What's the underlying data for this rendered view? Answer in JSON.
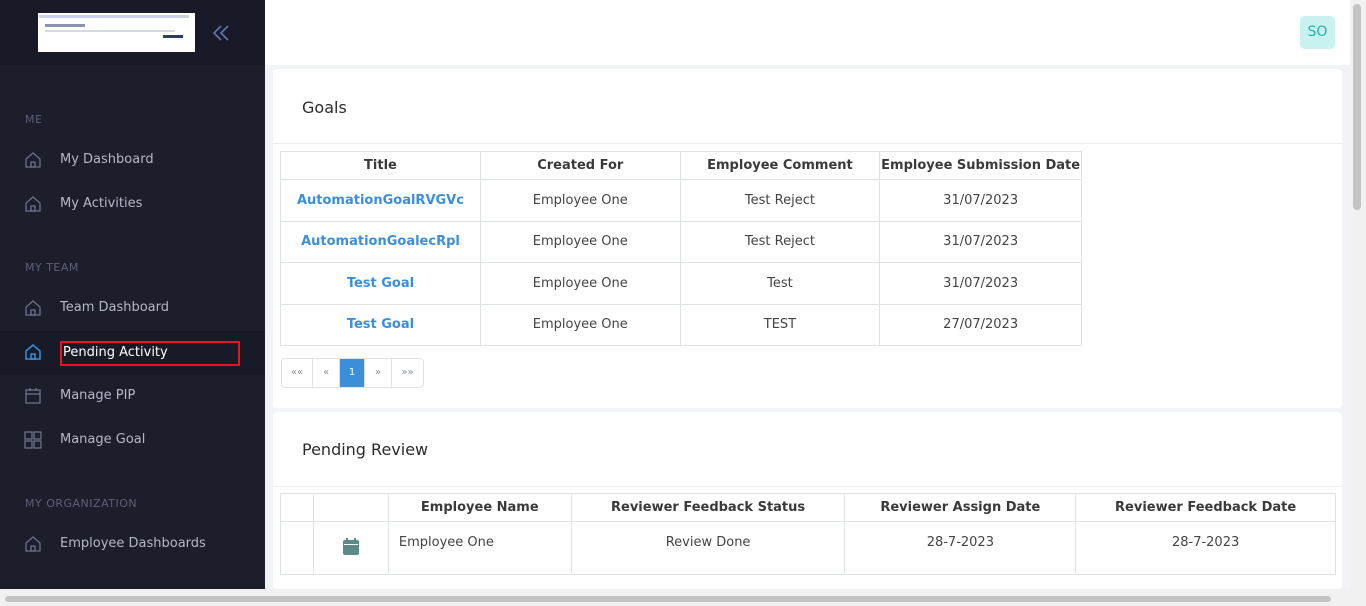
{
  "sidebar": {
    "sections": {
      "me": "ME",
      "my_team": "MY TEAM",
      "my_org": "MY ORGANIZATION"
    },
    "items": [
      {
        "label": "My Dashboard",
        "icon": "home-icon"
      },
      {
        "label": "My Activities",
        "icon": "home-icon"
      },
      {
        "label": "Team Dashboard",
        "icon": "home-icon"
      },
      {
        "label": "Pending Activity",
        "icon": "home-icon",
        "active": true
      },
      {
        "label": "Manage PIP",
        "icon": "calendar-icon"
      },
      {
        "label": "Manage Goal",
        "icon": "grid-icon"
      },
      {
        "label": "Employee Dashboards",
        "icon": "home-icon"
      }
    ]
  },
  "header": {
    "avatar_initials": "SO"
  },
  "goals": {
    "title": "Goals",
    "columns": [
      "Title",
      "Created For",
      "Employee Comment",
      "Employee Submission Date"
    ],
    "rows": [
      [
        "AutomationGoalRVGVc",
        "Employee One",
        "Test Reject",
        "31/07/2023"
      ],
      [
        "AutomationGoalecRpl",
        "Employee One",
        "Test Reject",
        "31/07/2023"
      ],
      [
        "Test Goal",
        "Employee One",
        "Test",
        "31/07/2023"
      ],
      [
        "Test Goal",
        "Employee One",
        "TEST",
        "27/07/2023"
      ]
    ],
    "pager": {
      "first": "««",
      "prev": "«",
      "current": "1",
      "next": "»",
      "last": "»»"
    }
  },
  "review": {
    "title": "Pending Review",
    "columns": [
      "",
      "",
      "Employee Name",
      "Reviewer Feedback Status",
      "Reviewer Assign Date",
      "Reviewer Feedback Date"
    ],
    "rows": [
      [
        "",
        "",
        "Employee One",
        "Review Done",
        "28-7-2023",
        "28-7-2023"
      ]
    ]
  },
  "colors": {
    "accent": "#3b8fd9",
    "sidebar_bg": "#1d1e2c",
    "highlight_border": "#e8141e",
    "avatar_bg": "#c9f1ef",
    "avatar_text": "#1fb5ad"
  }
}
